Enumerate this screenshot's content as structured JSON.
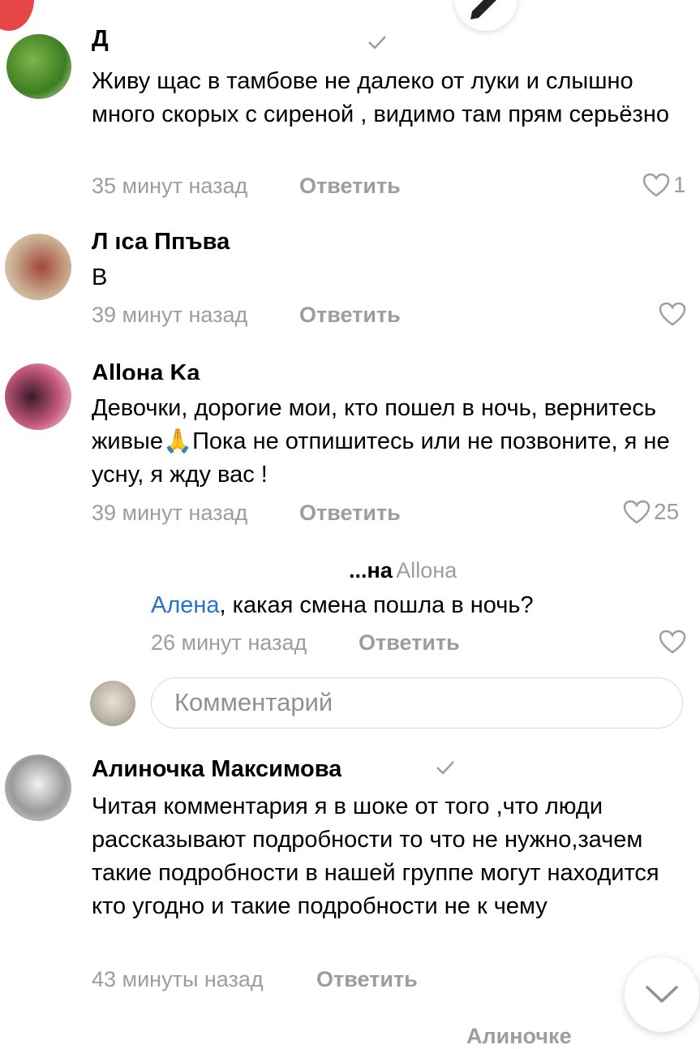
{
  "comments": [
    {
      "author": "Д",
      "text": "Живу щас в тамбове не далеко от луки и слышно много скорых с сиреной , видимо там прям серьёзно",
      "time": "35 минут назад",
      "reply_label": "Ответить",
      "likes": "1"
    },
    {
      "author": "Л    ıса Ппъва",
      "text": "В",
      "time": "39 минут назад",
      "reply_label": "Ответить",
      "likes": ""
    },
    {
      "author": "Alloна Ka",
      "text": "Девочки, дорогие мои, кто пошел в ночь, вернитесь живые🙏Пока не отпишитесь или не позвоните, я не усну, я жду вас !",
      "time": "39 минут назад",
      "reply_label": "Ответить",
      "likes": "25"
    }
  ],
  "reply": {
    "author_fragment": "...на",
    "to_name": "Alloна",
    "mention": "Алена",
    "text": ", какая смена пошла в ночь?",
    "time": "26 минут назад",
    "reply_label": "Ответить"
  },
  "comment_input": {
    "placeholder": "Комментарий"
  },
  "comment4": {
    "author": "Алиночка Максимова",
    "text": "Читая комментария я в шоке от того ,что люди рассказывают подробности то что не нужно,зачем такие подробности в нашей группе могут находится кто угодно и такие подробности не к чему",
    "time": "43 минуты назад",
    "reply_label": "Ответить"
  },
  "footer_partial": "Алиночке",
  "colors": {
    "meta_gray": "#9a9da3",
    "link_blue": "#2a72c4",
    "close_red": "#e64646"
  }
}
